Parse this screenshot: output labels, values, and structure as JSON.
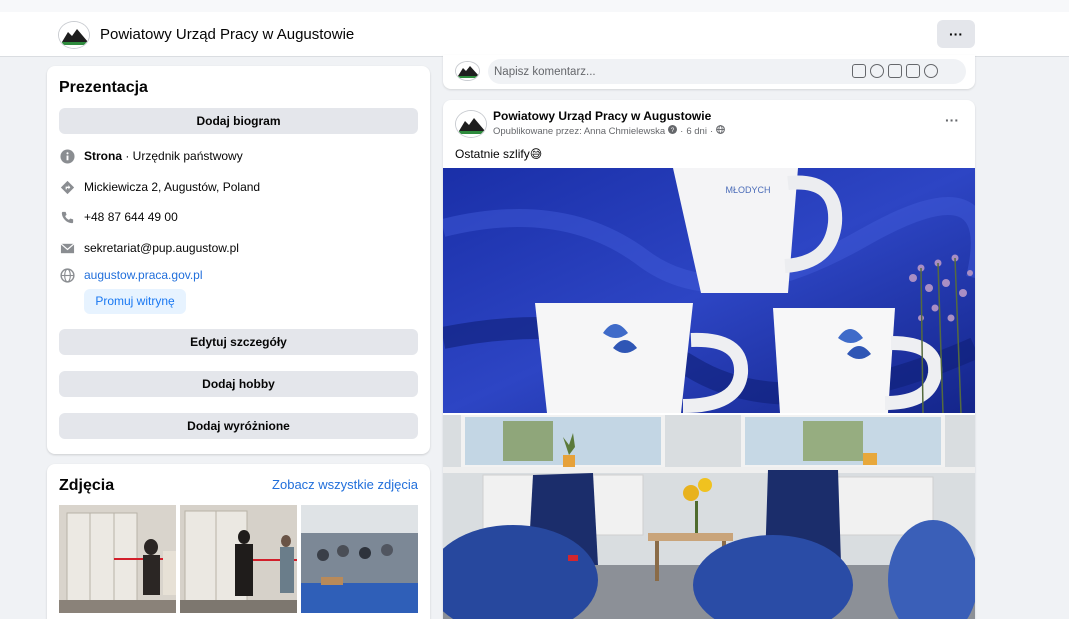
{
  "header": {
    "page_name": "Powiatowy Urząd Pracy w Augustowie",
    "more_label": "···"
  },
  "intro": {
    "title": "Prezentacja",
    "add_bio": "Dodaj biogram",
    "category_bold": "Strona",
    "category_rest": " · Urzędnik państwowy",
    "address": "Mickiewicza 2, Augustów, Poland",
    "phone": "+48 87 644 49 00",
    "email": "sekretariat@pup.augustow.pl",
    "website": "augustow.praca.gov.pl",
    "promote": "Promuj witrynę",
    "edit_details": "Edytuj szczegóły",
    "add_hobby": "Dodaj hobby",
    "add_featured": "Dodaj wyróżnione"
  },
  "photos": {
    "title": "Zdjęcia",
    "see_all": "Zobacz wszystkie zdjęcia"
  },
  "comment": {
    "placeholder": "Napisz komentarz..."
  },
  "post": {
    "author": "Powiatowy Urząd Pracy w Augustowie",
    "published_by": "Opublikowane przez: Anna Chmielewska",
    "time": "6 dni",
    "more_label": "···",
    "text": "Ostatnie szlify",
    "emoji": "😅"
  },
  "colors": {
    "accent": "#1877f2",
    "link": "#216fdb",
    "button_bg": "#e4e6eb",
    "page_bg": "#f0f2f5"
  }
}
